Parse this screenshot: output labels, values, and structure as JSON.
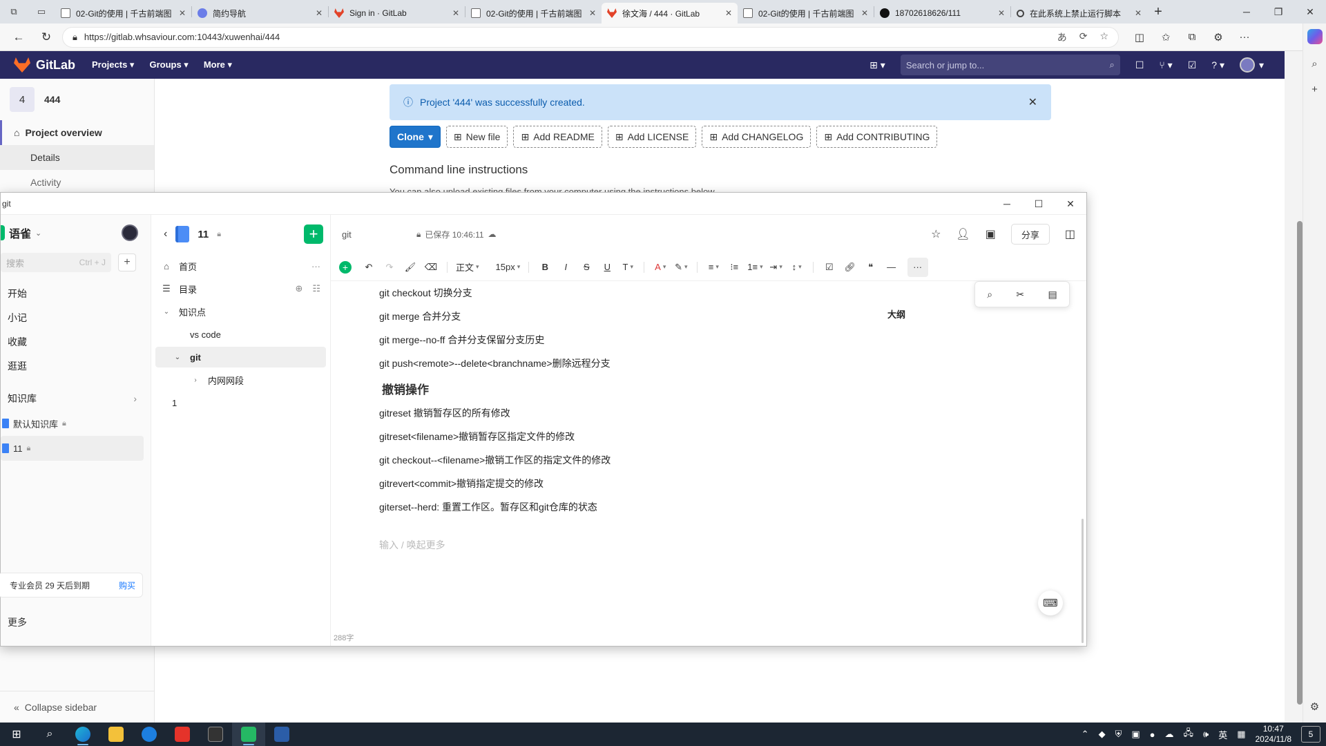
{
  "browser": {
    "tabs": [
      {
        "title": "02-Git的使用 | 千古前端图",
        "icon": "page-icon",
        "active": false
      },
      {
        "title": "简约导航",
        "icon": "nav-icon",
        "active": false
      },
      {
        "title": "Sign in · GitLab",
        "icon": "gitlab-icon",
        "active": false
      },
      {
        "title": "02-Git的使用 | 千古前端图",
        "icon": "page-icon",
        "active": false
      },
      {
        "title": "徐文海 / 444 · GitLab",
        "icon": "gitlab-icon",
        "active": true
      },
      {
        "title": "02-Git的使用 | 千古前端图",
        "icon": "page-icon",
        "active": false
      },
      {
        "title": "18702618626/111",
        "icon": "github-icon",
        "active": false
      },
      {
        "title": "在此系统上禁止运行脚本",
        "icon": "search-icon",
        "active": false
      }
    ],
    "url": "https://gitlab.whsaviour.com:10443/xuwenhai/444"
  },
  "gitlab": {
    "logo_text": "GitLab",
    "menus": [
      "Projects",
      "Groups",
      "More"
    ],
    "search_placeholder": "Search or jump to...",
    "project_avatar": "4",
    "project_name": "444",
    "sidebar": {
      "overview": "Project overview",
      "details": "Details",
      "activity": "Activity",
      "collapse": "Collapse sidebar"
    },
    "alert": "Project '444' was successfully created.",
    "actions": [
      "New file",
      "Add README",
      "Add LICENSE",
      "Add CHANGELOG",
      "Add CONTRIBUTING"
    ],
    "clone_label": "Clone",
    "section_title": "Command line instructions",
    "section_sub": "You can also upload existing files from your computer using the instructions below."
  },
  "yuque": {
    "window_title": "git",
    "brand": "语雀",
    "search_placeholder": "搜索",
    "search_shortcut": "Ctrl + J",
    "nav": [
      "开始",
      "小记",
      "收藏",
      "逛逛"
    ],
    "kb_label": "知识库",
    "books": [
      {
        "name": "默认知识库",
        "active": false
      },
      {
        "name": "11",
        "active": true
      }
    ],
    "vip_text": "专业会员 29 天后到期",
    "vip_buy": "购买",
    "more": "更多",
    "tree_title": "11",
    "tree": {
      "home": "首页",
      "toc": "目录",
      "group": "知识点",
      "items": [
        "vs code",
        "git",
        "内网网段"
      ],
      "extra": "1"
    },
    "doc_title": "git",
    "saved": "已保存 10:46:11",
    "share": "分享",
    "toolbar": {
      "style": "正文",
      "size": "15px"
    },
    "outline": "大纲",
    "lines_top": [
      "git checkout 切换分支",
      "git merge 合并分支",
      "git merge--no-ff 合并分支保留分支历史",
      "git push<remote>--delete<branchname>删除远程分支"
    ],
    "heading": "撤销操作",
    "lines_bottom": [
      "gitreset 撤销暂存区的所有修改",
      "gitreset<filename>撤销暂存区指定文件的修改",
      "git checkout--<filename>撤销工作区的指定文件的修改",
      "gitrevert<commit>撤销指定提交的修改",
      "giterset--herd: 重置工作区。暂存区和git仓库的状态"
    ],
    "placeholder": "输入 / 唤起更多",
    "word_count": "288字"
  },
  "taskbar": {
    "time": "10:47",
    "date": "2024/11/8",
    "ime": "英",
    "notifications": "5"
  }
}
